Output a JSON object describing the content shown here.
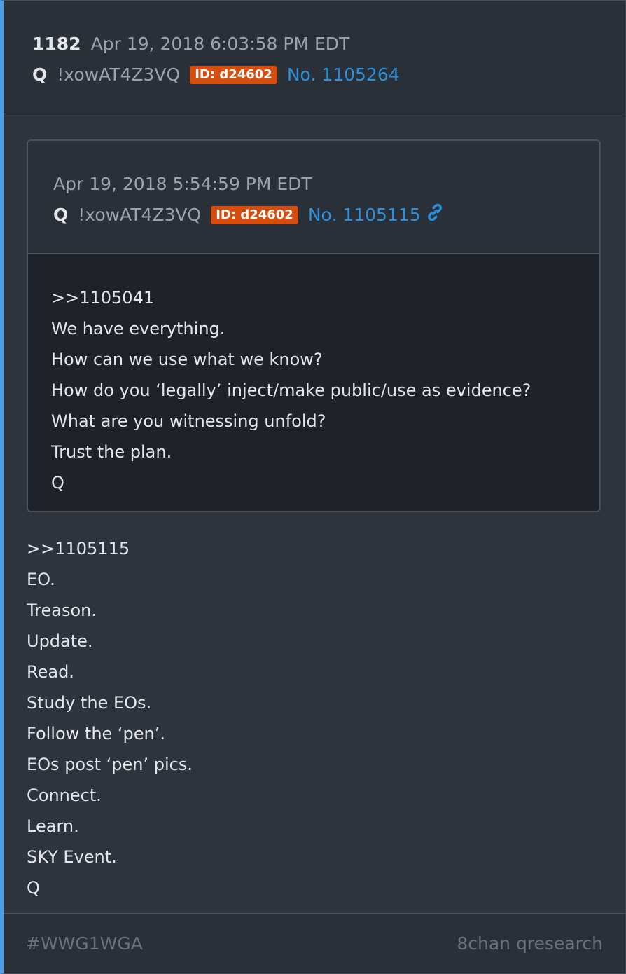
{
  "post": {
    "number": "1182",
    "date": "Apr 19, 2018 6:03:58 PM EDT",
    "name": "Q",
    "tripcode": "!xowAT4Z3VQ",
    "id_badge": "ID: d24602",
    "post_link": "No. 1105264"
  },
  "quoted": {
    "date": "Apr 19, 2018 5:54:59 PM EDT",
    "name": "Q",
    "tripcode": "!xowAT4Z3VQ",
    "id_badge": "ID: d24602",
    "post_link": "No. 1105115",
    "lines": [
      ">>1105041",
      "We have everything.",
      "How can we use what we know?",
      "How do you ‘legally’ inject/make public/use as evidence?",
      "What are you witnessing unfold?",
      "Trust the plan.",
      "Q"
    ]
  },
  "body_lines": [
    ">>1105115",
    "EO.",
    "Treason.",
    "Update.",
    "Read.",
    "Study the EOs.",
    "Follow the ‘pen’.",
    "EOs post ‘pen’ pics.",
    "Connect.",
    "Learn.",
    "SKY Event.",
    "Q"
  ],
  "footer": {
    "hashtag": "#WWG1WGA",
    "source": "8chan qresearch"
  },
  "colors": {
    "accent_border": "#4a9fe8",
    "id_badge": "#d64d10",
    "link": "#2c8fd8"
  },
  "icons": {
    "quoted_link": "link-icon"
  }
}
